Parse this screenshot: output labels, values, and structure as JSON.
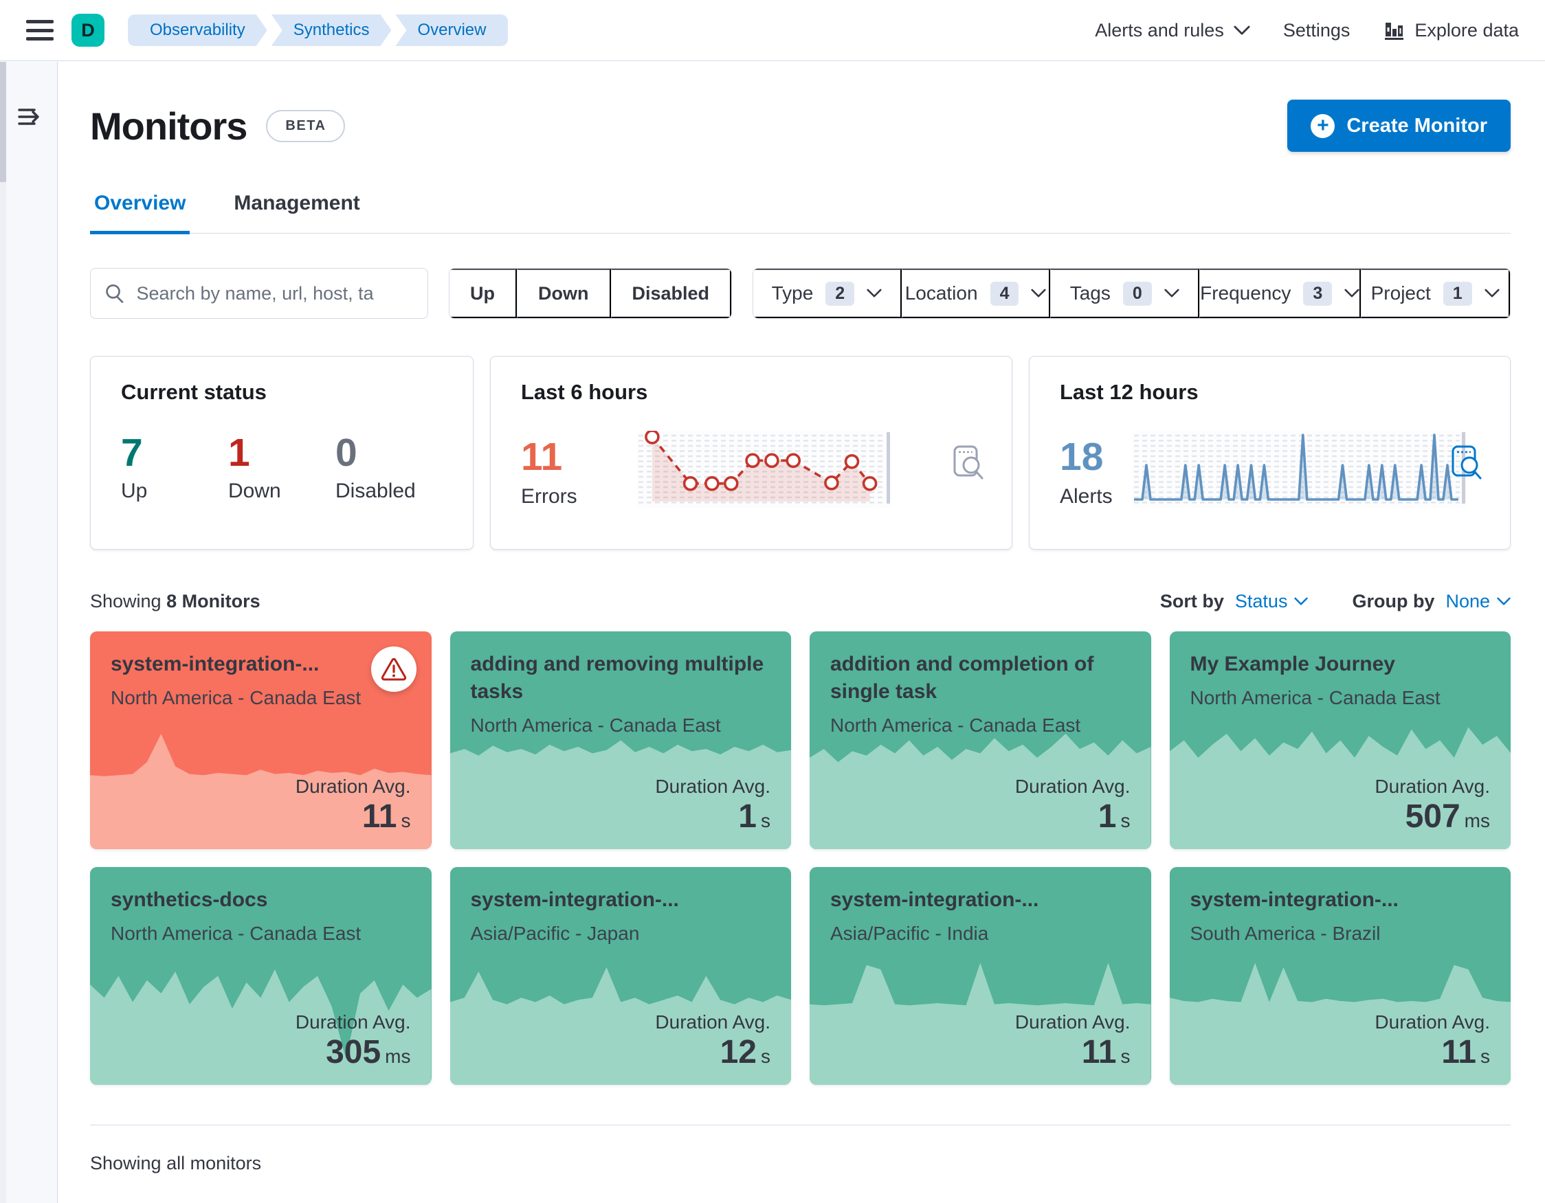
{
  "header": {
    "avatar_letter": "D",
    "breadcrumbs": [
      "Observability",
      "Synthetics",
      "Overview"
    ],
    "alerts_menu_label": "Alerts and rules",
    "settings_label": "Settings",
    "explore_label": "Explore data"
  },
  "page": {
    "title": "Monitors",
    "beta_label": "BETA",
    "create_button_label": "Create Monitor",
    "tabs": [
      {
        "label": "Overview",
        "active": true
      },
      {
        "label": "Management",
        "active": false
      }
    ]
  },
  "filters": {
    "search_placeholder": "Search by name, url, host, ta",
    "status_buttons": [
      "Up",
      "Down",
      "Disabled"
    ],
    "dropdowns": [
      {
        "label": "Type",
        "count": "2"
      },
      {
        "label": "Location",
        "count": "4"
      },
      {
        "label": "Tags",
        "count": "0"
      },
      {
        "label": "Frequency",
        "count": "3"
      },
      {
        "label": "Project",
        "count": "1"
      }
    ]
  },
  "summary": {
    "status": {
      "title": "Current status",
      "up_value": "7",
      "up_label": "Up",
      "down_value": "1",
      "down_label": "Down",
      "disabled_value": "0",
      "disabled_label": "Disabled"
    }
  },
  "chart_data": [
    {
      "id": "errors_trend",
      "type": "area",
      "title": "Last 6 hours",
      "metric_value": "11",
      "metric_label": "Errors",
      "style": "dashed-line-with-markers",
      "line_color": "#C4362C",
      "fill_color": "rgba(196,54,44,0.14)",
      "grid": "dashed-rows",
      "x_fractions": [
        0.04,
        0.2,
        0.29,
        0.37,
        0.46,
        0.54,
        0.63,
        0.79,
        0.875,
        0.95
      ],
      "values_estimate": [
        4,
        1,
        1,
        1,
        2,
        2,
        2,
        1,
        2,
        1
      ],
      "y_fractions_from_top": [
        0.03,
        0.73,
        0.73,
        0.73,
        0.385,
        0.385,
        0.385,
        0.72,
        0.4,
        0.73
      ],
      "ylim": [
        0,
        4
      ]
    },
    {
      "id": "alerts_trend",
      "type": "area",
      "title": "Last 12 hours",
      "metric_value": "18",
      "metric_label": "Alerts",
      "style": "spiky-line",
      "line_color": "#6092C0",
      "fill_color": "rgba(96,146,192,0.25)",
      "grid": "dashed-rows",
      "spike_x_fractions": [
        0.026,
        0.149,
        0.191,
        0.273,
        0.314,
        0.356,
        0.397,
        0.519,
        0.644,
        0.727,
        0.768,
        0.809,
        0.892,
        0.933,
        0.974
      ],
      "spike_values": [
        1,
        1,
        1,
        1,
        1,
        1,
        1,
        2,
        1,
        1,
        1,
        1,
        1,
        2,
        1
      ],
      "ylim": [
        0,
        2
      ]
    }
  ],
  "monitors": {
    "showing_prefix": "Showing",
    "showing_count": "8 Monitors",
    "sort_by_label": "Sort by",
    "sort_by_value": "Status",
    "group_by_label": "Group by",
    "group_by_value": "None",
    "duration_label": "Duration Avg.",
    "cards": [
      {
        "title": "system-integration-...",
        "location": "North America - Canada East",
        "value": "11",
        "unit": "s",
        "status": "down",
        "spark": [
          0.66,
          0.665,
          0.66,
          0.655,
          0.6,
          0.47,
          0.62,
          0.655,
          0.66,
          0.65,
          0.655,
          0.66,
          0.635,
          0.655,
          0.65,
          0.66,
          0.64,
          0.65,
          0.645,
          0.66,
          0.63,
          0.65,
          0.645,
          0.655,
          0.66
        ]
      },
      {
        "title": "adding and removing multiple tasks",
        "location": "North America - Canada East",
        "value": "1",
        "unit": "s",
        "status": "up",
        "spark": [
          0.56,
          0.54,
          0.57,
          0.525,
          0.555,
          0.54,
          0.565,
          0.52,
          0.55,
          0.53,
          0.56,
          0.545,
          0.5,
          0.555,
          0.53,
          0.56,
          0.52,
          0.55,
          0.54,
          0.565,
          0.53,
          0.55,
          0.52,
          0.555,
          0.545
        ]
      },
      {
        "title": "addition and completion of single task",
        "location": "North America - Canada East",
        "value": "1",
        "unit": "s",
        "status": "up",
        "spark": [
          0.58,
          0.54,
          0.6,
          0.55,
          0.57,
          0.52,
          0.56,
          0.5,
          0.57,
          0.53,
          0.59,
          0.54,
          0.56,
          0.49,
          0.55,
          0.52,
          0.58,
          0.53,
          0.47,
          0.54,
          0.51,
          0.57,
          0.5,
          0.56,
          0.53
        ]
      },
      {
        "title": "My Example Journey",
        "location": "North America - Canada East",
        "value": "507",
        "unit": "ms",
        "status": "up",
        "spark": [
          0.55,
          0.5,
          0.58,
          0.52,
          0.47,
          0.55,
          0.49,
          0.57,
          0.51,
          0.54,
          0.46,
          0.56,
          0.5,
          0.58,
          0.48,
          0.53,
          0.57,
          0.45,
          0.54,
          0.5,
          0.58,
          0.44,
          0.52,
          0.48,
          0.56
        ]
      },
      {
        "title": "synthetics-docs",
        "location": "North America - Canada East",
        "value": "305",
        "unit": "ms",
        "status": "up",
        "spark": [
          0.54,
          0.6,
          0.5,
          0.62,
          0.52,
          0.58,
          0.48,
          0.63,
          0.55,
          0.5,
          0.65,
          0.53,
          0.6,
          0.47,
          0.62,
          0.55,
          0.5,
          0.64,
          0.88,
          0.58,
          0.52,
          0.66,
          0.54,
          0.6,
          0.56
        ]
      },
      {
        "title": "system-integration-...",
        "location": "Asia/Pacific - Japan",
        "value": "12",
        "unit": "s",
        "status": "up",
        "spark": [
          0.62,
          0.6,
          0.48,
          0.61,
          0.63,
          0.6,
          0.62,
          0.59,
          0.63,
          0.61,
          0.6,
          0.46,
          0.62,
          0.6,
          0.63,
          0.61,
          0.59,
          0.62,
          0.5,
          0.61,
          0.63,
          0.6,
          0.62,
          0.59,
          0.61
        ]
      },
      {
        "title": "system-integration-...",
        "location": "Asia/Pacific - India",
        "value": "11",
        "unit": "s",
        "status": "up",
        "spark": [
          0.63,
          0.635,
          0.63,
          0.625,
          0.45,
          0.47,
          0.63,
          0.635,
          0.63,
          0.625,
          0.63,
          0.635,
          0.44,
          0.63,
          0.625,
          0.63,
          0.635,
          0.63,
          0.625,
          0.63,
          0.635,
          0.44,
          0.63,
          0.625,
          0.63
        ]
      },
      {
        "title": "system-integration-...",
        "location": "South America - Brazil",
        "value": "11",
        "unit": "s",
        "status": "up",
        "spark": [
          0.6,
          0.615,
          0.62,
          0.605,
          0.615,
          0.62,
          0.44,
          0.62,
          0.46,
          0.615,
          0.62,
          0.605,
          0.615,
          0.62,
          0.61,
          0.605,
          0.62,
          0.615,
          0.62,
          0.605,
          0.45,
          0.47,
          0.6,
          0.615,
          0.62
        ]
      }
    ]
  },
  "footer": {
    "text": "Showing all monitors"
  },
  "colors": {
    "primary_blue": "#0077CC",
    "brand_teal": "#00BFB3",
    "up_green": "#54B399",
    "up_green_area": "#9CD5C4",
    "down_red": "#F8705E",
    "down_red_area": "#FAAB9B",
    "success_text": "#007871",
    "danger_text": "#BD271E",
    "errors_accent": "#E7664C",
    "alerts_accent": "#6092C0",
    "border": "#D3DAE6",
    "text": "#343741"
  }
}
